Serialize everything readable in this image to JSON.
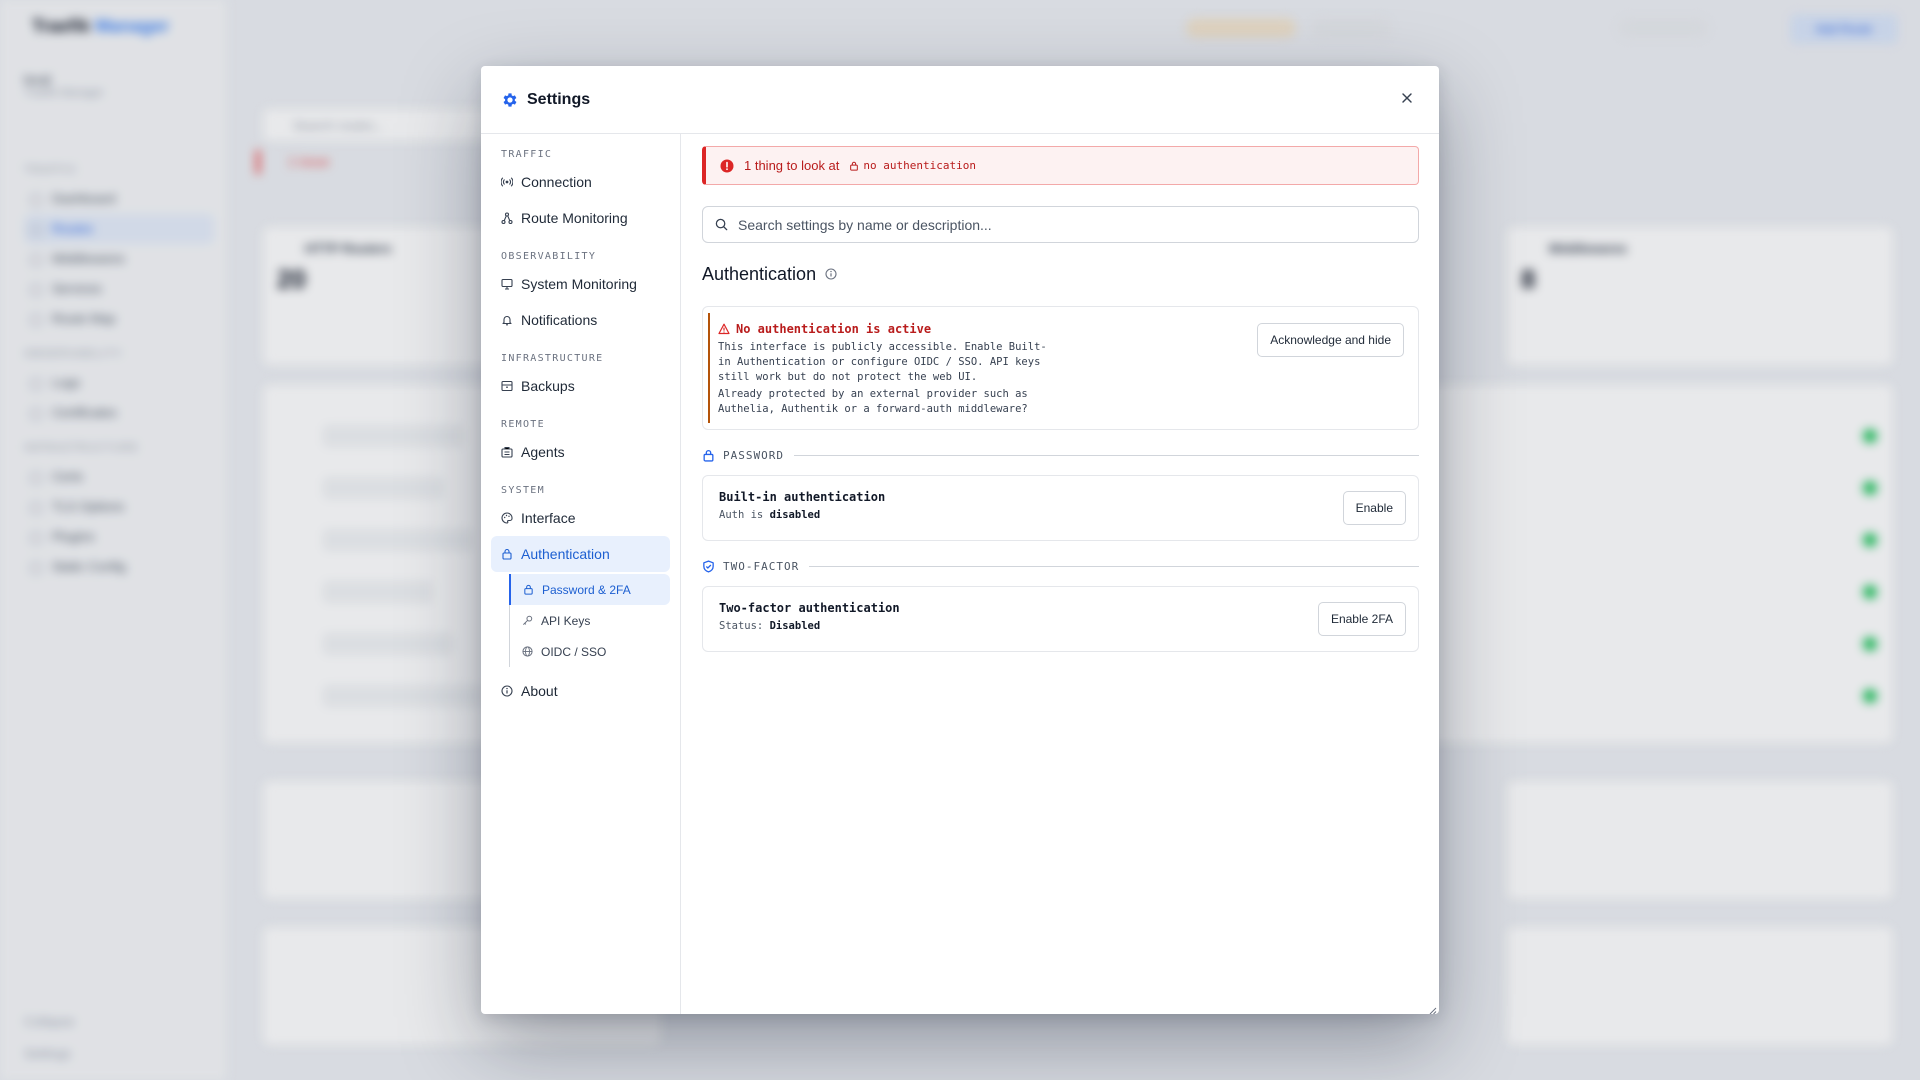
{
  "background": {
    "brand_name": "Traefik",
    "brand_accent": "Manager",
    "env_name": "local",
    "env_sub": "Traefik Manager",
    "add_button": "Add Route",
    "search_placeholder": "Search routes...",
    "alert_text": "1 issue",
    "card_title": "HTTP Routers",
    "card_value": "20",
    "card2_title": "Middlewares",
    "card2_value": "8",
    "footer_1": "Collapse",
    "footer_2": "Settings",
    "nav_sections": [
      "TRAFFIC",
      "OBSERVABILITY",
      "INFRASTRUCTURE"
    ],
    "nav_items": [
      "Dashboard",
      "Routes",
      "Middlewares",
      "Services",
      "Route Map",
      "Logs",
      "Certificates",
      "Certs",
      "TLS Options",
      "Plugins",
      "Static Config"
    ]
  },
  "modal": {
    "title": "Settings",
    "close_label": "×"
  },
  "nav": {
    "sections": {
      "traffic": "TRAFFIC",
      "observability": "OBSERVABILITY",
      "infrastructure": "INFRASTRUCTURE",
      "remote": "REMOTE",
      "system": "SYSTEM"
    },
    "items": {
      "connection": "Connection",
      "route_monitoring": "Route Monitoring",
      "system_monitoring": "System Monitoring",
      "notifications": "Notifications",
      "backups": "Backups",
      "agents": "Agents",
      "interface": "Interface",
      "authentication": "Authentication",
      "about": "About"
    },
    "sub_items": {
      "password_2fa": "Password & 2FA",
      "api_keys": "API Keys",
      "oidc_sso": "OIDC / SSO"
    }
  },
  "main": {
    "alert": {
      "text": "1 thing to look at",
      "chip": "no authentication"
    },
    "search_placeholder": "Search settings by name or description...",
    "section_title": "Authentication",
    "warning": {
      "title": "No authentication is active",
      "body": "This interface is publicly accessible. Enable Built-in Authentication or configure OIDC / SSO. API keys still work but do not protect the web UI.",
      "body2": "Already protected by an external provider such as Authelia, Authentik or a forward-auth middleware?",
      "button": "Acknowledge and hide"
    },
    "password_group": {
      "label": "PASSWORD",
      "card_title": "Built-in authentication",
      "status_prefix": "Auth is",
      "status_value": "disabled",
      "button": "Enable"
    },
    "twofactor_group": {
      "label": "TWO-FACTOR",
      "card_title": "Two-factor authentication",
      "status_prefix": "Status:",
      "status_value": "Disabled",
      "button": "Enable 2FA"
    }
  },
  "colors": {
    "accent": "#2563eb",
    "danger": "#dc2626",
    "warning": "#b45309"
  }
}
